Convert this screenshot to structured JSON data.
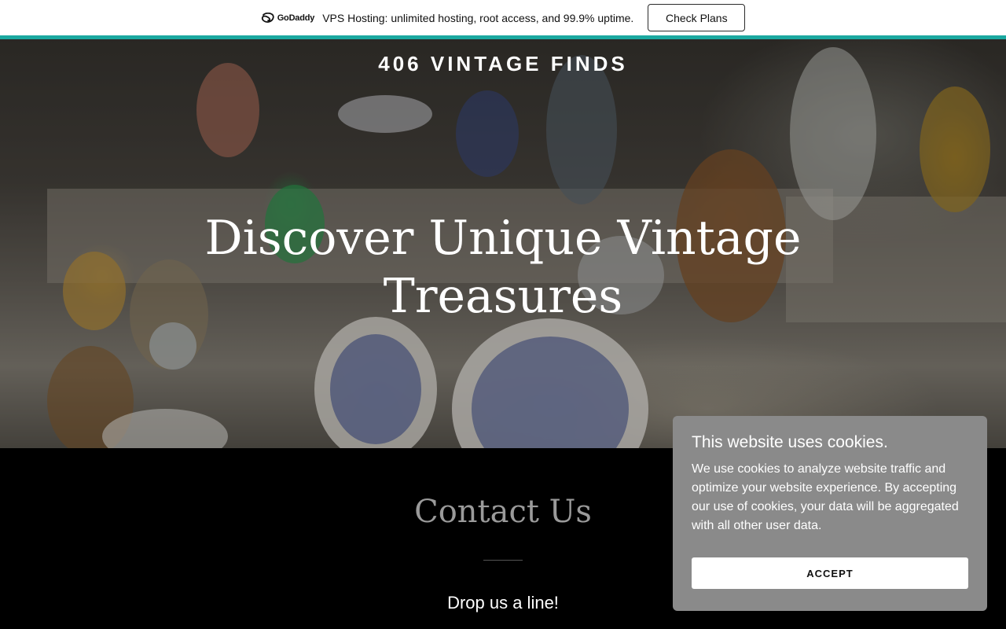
{
  "promo": {
    "logo_text": "GoDaddy",
    "message": "VPS Hosting: unlimited hosting, root access, and 99.9% uptime.",
    "button_label": "Check Plans",
    "accent_color": "#1ba8a0"
  },
  "hero": {
    "brand": "406 VINTAGE FINDS",
    "title": "Discover Unique Vintage Treasures"
  },
  "contact": {
    "title": "Contact Us",
    "subtitle": "Drop us a line!"
  },
  "cookie_banner": {
    "title": "This website uses cookies.",
    "body": "We use cookies to analyze website traffic and optimize your website experience. By accepting our use of cookies, your data will be aggregated with all other user data.",
    "accept_label": "ACCEPT"
  }
}
